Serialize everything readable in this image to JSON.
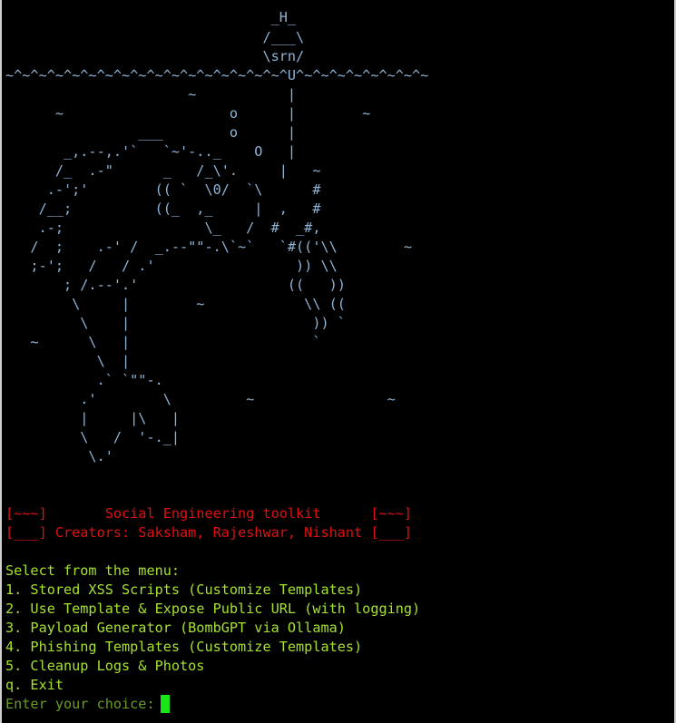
{
  "art_lines": [
    "                                _H_",
    "                               /___\\",
    "                               \\srn/",
    "~^~^~^~^~^~^~^~^~^~^~^~^~^~^~^~^~^U^~^~^~^~^~^~^~^~",
    "                      ~           |",
    "      ~                    o      |        ~",
    "                ___        o      |",
    "       _,.--,.'`   `~'-.._    O   |",
    "      /_  .-\"      _   /_\\'.     |   ~",
    "     .-';'        (( `  \\0/  `\\      #",
    "    /__;          ((_  ,_     |  ,   #",
    "    .-;                 \\_   /  #  _#,",
    "   /  ;    .-' /  _.--\"\"-.\\`~`   `#(('\\\\        ~",
    "   ;-';   /   / .'                 )) \\\\",
    "       ; /.--'.'                  ((   ))",
    "        \\     |        ~            \\\\ ((",
    "         \\    |                      )) `",
    "   ~      \\   |                      `",
    "           \\  |",
    "           .` `\"\"-.",
    "         .'        \\         ~                ~",
    "         |     |\\   |",
    "         \\   /  '-._|",
    "          \\.'"
  ],
  "banner": {
    "line1": "[~~~]       Social Engineering toolkit      [~~~]",
    "line2": "[___] Creators: Saksham, Rajeshwar, Nishant [___]"
  },
  "menu": {
    "header": "Select from the menu:",
    "items": [
      "1. Stored XSS Scripts (Customize Templates)",
      "2. Use Template & Expose Public URL (with logging)",
      "3. Payload Generator (BombGPT via Ollama)",
      "4. Phishing Templates (Customize Templates)",
      "5. Cleanup Logs & Photos",
      "q. Exit"
    ]
  },
  "prompt": {
    "label": "Enter your choice: "
  },
  "colors": {
    "background": "#000000",
    "art": "#8fb5d6",
    "banner": "#e01010",
    "menu": "#a6e22e",
    "prompt": "#6a9b23",
    "cursor": "#19e619"
  }
}
